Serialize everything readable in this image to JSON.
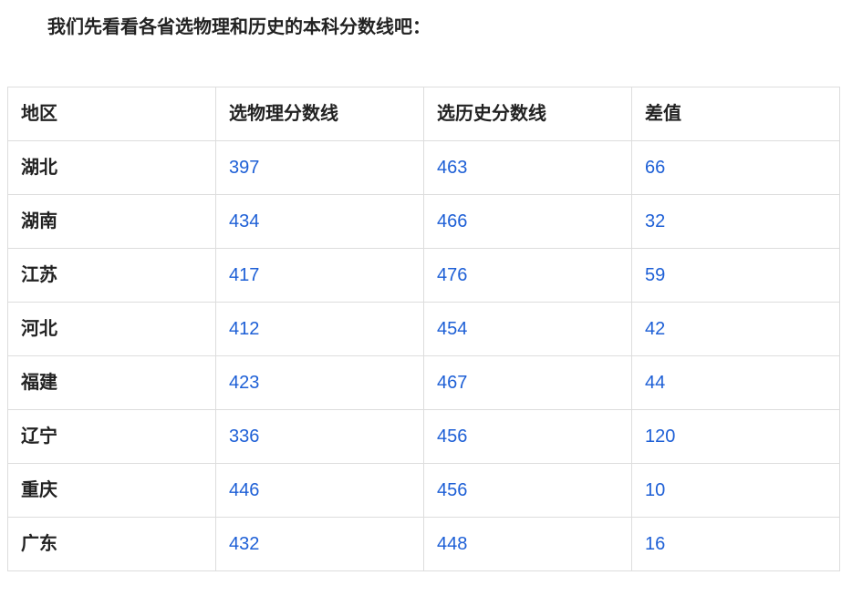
{
  "heading": "我们先看看各省选物理和历史的本科分数线吧：",
  "table": {
    "headers": [
      "地区",
      "选物理分数线",
      "选历史分数线",
      "差值"
    ],
    "rows": [
      {
        "region": "湖北",
        "physics": "397",
        "history": "463",
        "diff": "66"
      },
      {
        "region": "湖南",
        "physics": "434",
        "history": "466",
        "diff": "32"
      },
      {
        "region": "江苏",
        "physics": "417",
        "history": "476",
        "diff": "59"
      },
      {
        "region": "河北",
        "physics": "412",
        "history": "454",
        "diff": "42"
      },
      {
        "region": "福建",
        "physics": "423",
        "history": "467",
        "diff": "44"
      },
      {
        "region": "辽宁",
        "physics": "336",
        "history": "456",
        "diff": "120"
      },
      {
        "region": "重庆",
        "physics": "446",
        "history": "456",
        "diff": "10"
      },
      {
        "region": "广东",
        "physics": "432",
        "history": "448",
        "diff": "16"
      }
    ]
  },
  "colors": {
    "text": "#222222",
    "number": "#1d5fd6",
    "border": "#dddddd"
  }
}
